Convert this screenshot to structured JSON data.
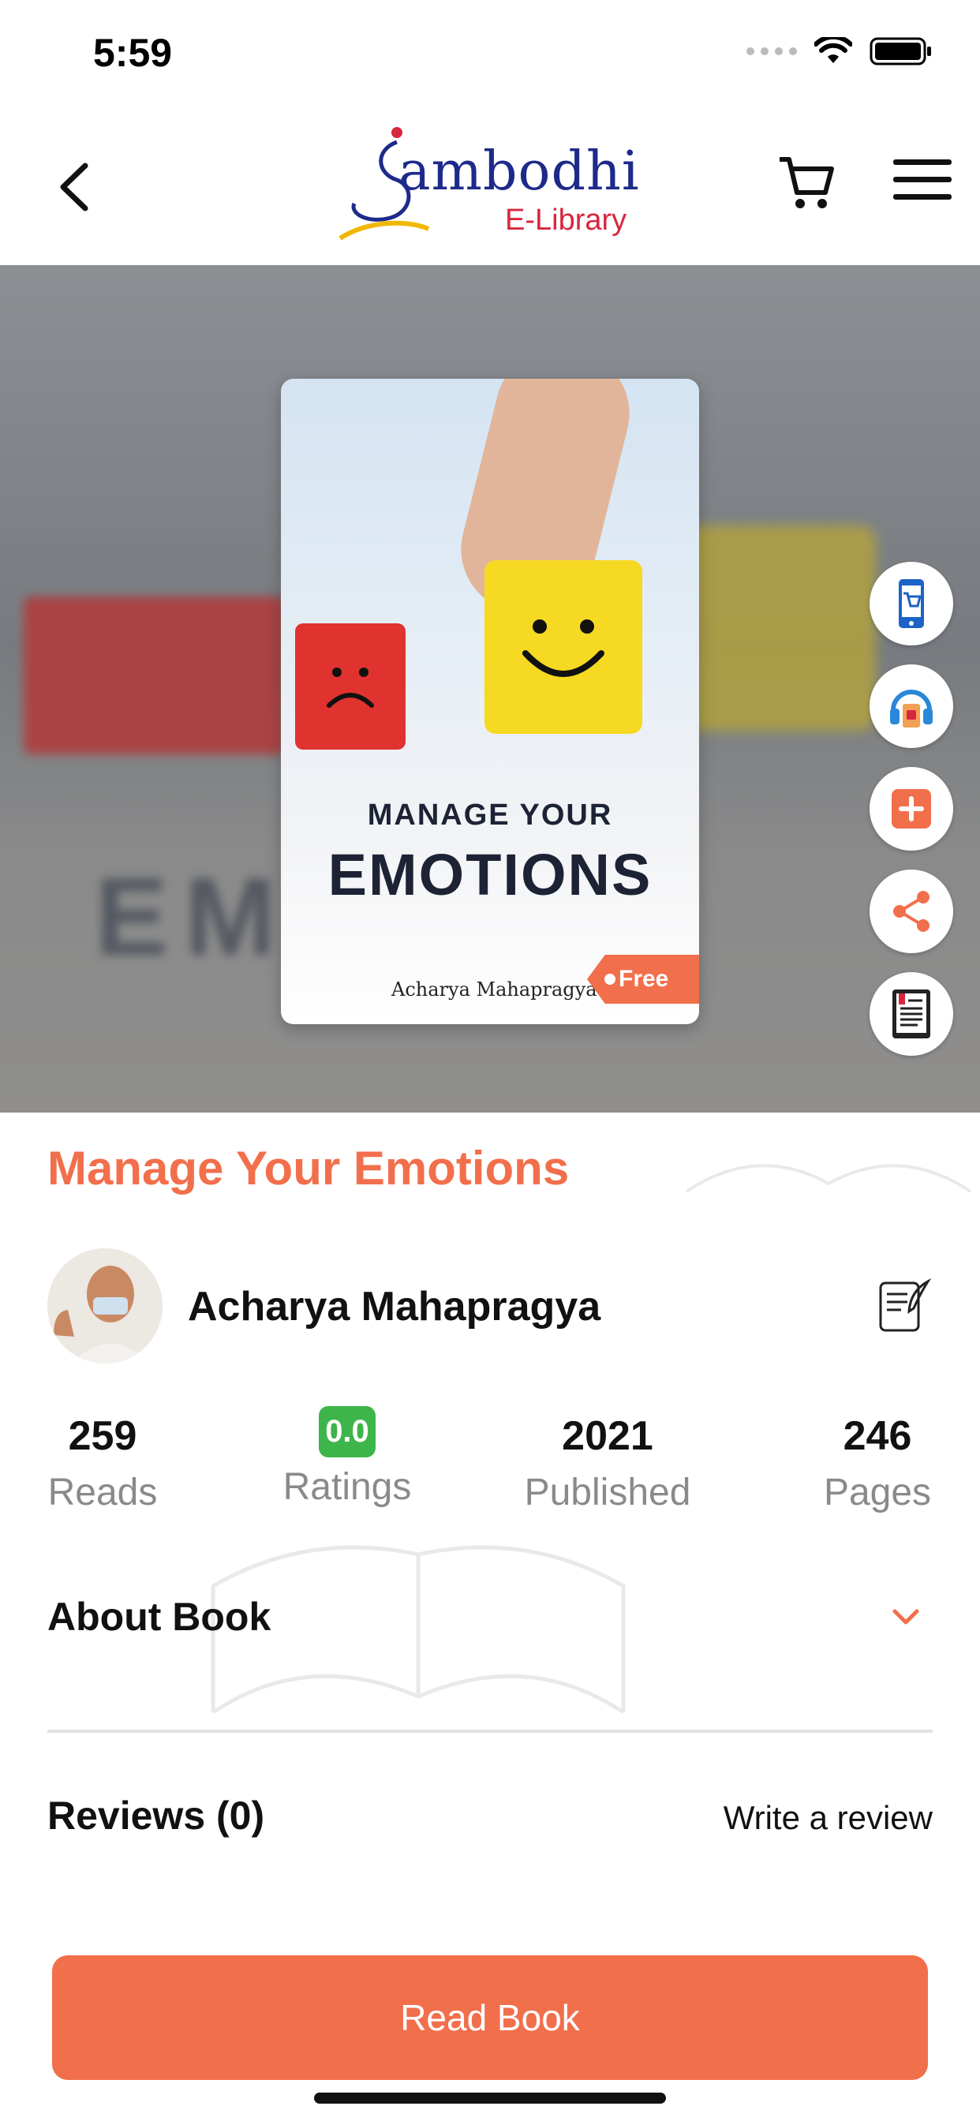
{
  "status_bar": {
    "time": "5:59"
  },
  "header": {
    "logo_main": "ambodhi",
    "logo_s": "S",
    "logo_sub": "E-Library"
  },
  "book": {
    "cover_title_line1": "MANAGE YOUR",
    "cover_title_line2": "EMOTIONS",
    "cover_author": "Acharya Mahapragya",
    "free_tag": "Free",
    "title": "Manage Your Emotions",
    "author": "Acharya Mahapragya"
  },
  "side_actions": [
    {
      "name": "buy-book-button",
      "icon": "phone-cart-icon"
    },
    {
      "name": "audiobook-button",
      "icon": "headphones-icon"
    },
    {
      "name": "add-to-library-button",
      "icon": "plus-icon"
    },
    {
      "name": "share-button",
      "icon": "share-icon"
    },
    {
      "name": "preview-button",
      "icon": "ebook-icon"
    }
  ],
  "stats": {
    "reads_value": "259",
    "reads_label": "Reads",
    "ratings_value": "0.0",
    "ratings_label": "Ratings",
    "published_value": "2021",
    "published_label": "Published",
    "pages_value": "246",
    "pages_label": "Pages"
  },
  "about": {
    "title": "About Book"
  },
  "reviews": {
    "title": "Reviews (0)",
    "write_label": "Write a review"
  },
  "read_button": "Read Book",
  "colors": {
    "accent": "#f26f4c",
    "rating_badge": "#3db54a",
    "logo_blue": "#1e2a8a",
    "logo_red": "#d7263d"
  }
}
